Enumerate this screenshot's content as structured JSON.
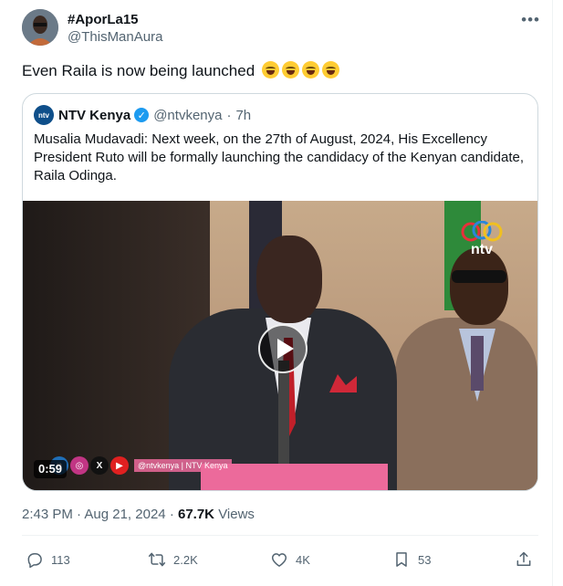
{
  "post": {
    "display_name": "#AporLa15",
    "handle": "@ThisManAura",
    "text": "Even Raila is now being launched",
    "emoji_icon": "face-with-tears-of-joy-icon",
    "more_icon": "more-options-icon"
  },
  "quote": {
    "avatar_text": "ntv",
    "name": "NTV Kenya",
    "handle": "@ntvkenya",
    "separator": "·",
    "time": "7h",
    "text": "Musalia Mudavadi: Next week, on the 27th of August, 2024, His Excellency President Ruto will be formally launching the candidacy of the Kenyan candidate, Raila Odinga.",
    "video": {
      "duration": "0:59",
      "watermark_handle": "@ntvkenya | NTV Kenya",
      "logo_text": "ntv"
    }
  },
  "meta": {
    "time": "2:43 PM",
    "separator": "·",
    "date": "Aug 21, 2024",
    "views_count": "67.7K",
    "views_label": "Views"
  },
  "actions": {
    "replies": "113",
    "reposts": "2.2K",
    "likes": "4K",
    "bookmarks": "53"
  },
  "colors": {
    "text": "#0f1419",
    "secondary": "#536471",
    "border": "#cfd9de",
    "verified": "#1d9bf0"
  }
}
